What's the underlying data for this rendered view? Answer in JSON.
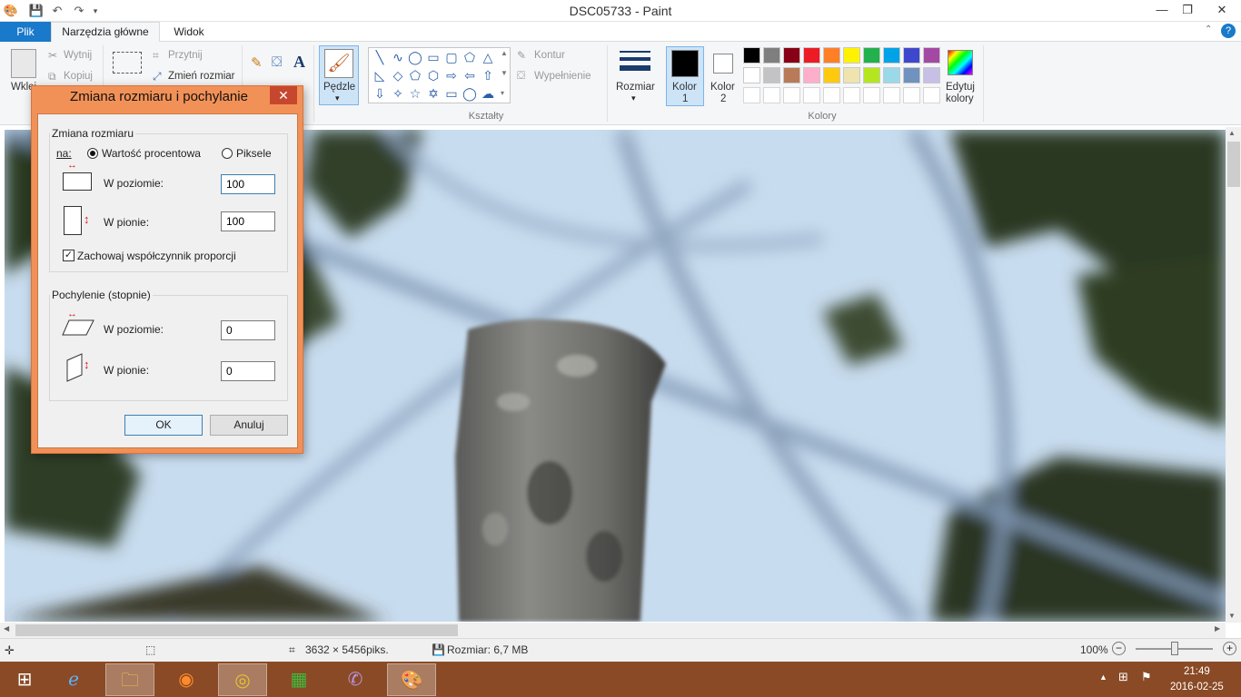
{
  "window": {
    "title": "DSC05733 - Paint"
  },
  "tabs": {
    "file": "Plik",
    "home": "Narzędzia główne",
    "view": "Widok"
  },
  "ribbon": {
    "paste": "Wklej",
    "cut": "Wytnij",
    "copy": "Kopiuj",
    "crop": "Przytnij",
    "resize": "Zmień rozmiar",
    "brushes": "Pędzle",
    "outline": "Kontur",
    "fill": "Wypełnienie",
    "shapes_group": "Kształty",
    "size": "Rozmiar",
    "color1": "Kolor",
    "color1_num": "1",
    "color2": "Kolor",
    "color2_num": "2",
    "edit_colors_1": "Edytuj",
    "edit_colors_2": "kolory",
    "colors_group": "Kolory",
    "palette_row1": [
      "#000000",
      "#7f7f7f",
      "#880015",
      "#ed1c24",
      "#ff7f27",
      "#fff200",
      "#22b14c",
      "#00a2e8",
      "#3f48cc",
      "#a349a4"
    ],
    "palette_row2": [
      "#ffffff",
      "#c3c3c3",
      "#b97a57",
      "#ffaec9",
      "#ffc90e",
      "#efe4b0",
      "#b5e61d",
      "#99d9ea",
      "#7092be",
      "#c8bfe7"
    ],
    "accent": "#1979ca"
  },
  "dialog": {
    "title": "Zmiana rozmiaru i pochylanie",
    "resize_legend": "Zmiana rozmiaru",
    "by_label": "na:",
    "percent": "Wartość procentowa",
    "pixels": "Piksele",
    "horizontal": "W poziomie:",
    "vertical": "W pionie:",
    "resize_h_value": "100",
    "resize_v_value": "100",
    "keep_ratio": "Zachowaj współczynnik proporcji",
    "skew_legend": "Pochylenie (stopnie)",
    "skew_h_value": "0",
    "skew_v_value": "0",
    "ok": "OK",
    "cancel": "Anuluj"
  },
  "status": {
    "dimensions": "3632 × 5456piks.",
    "size": "Rozmiar: 6,7 MB",
    "zoom": "100%"
  },
  "taskbar": {
    "time": "21:49",
    "date": "2016-02-25"
  }
}
